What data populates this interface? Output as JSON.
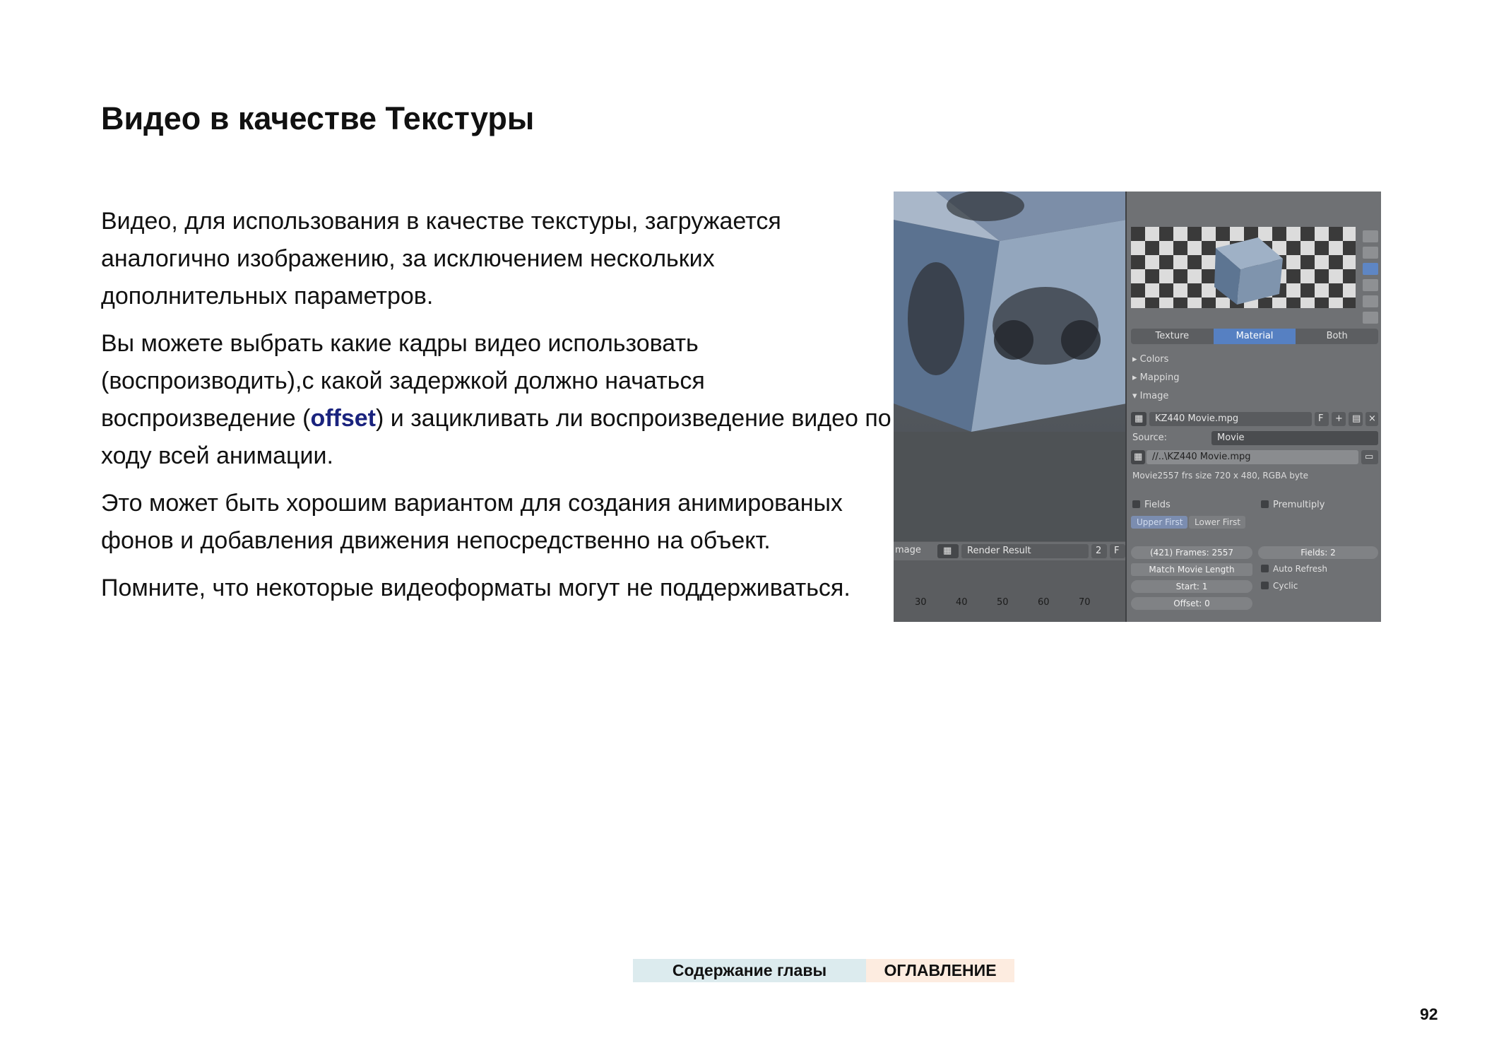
{
  "page": {
    "title": "Видео в качестве Текстуры",
    "paragraphs": {
      "p1": "Видео, для использования в качестве текстуры, загружается аналогично изображению, за исключением нескольких дополнительных параметров.",
      "p2_before": "Вы можете выбрать какие кадры видео использовать (воспроизводить),с какой задержкой должно начаться воспроизведение (",
      "p2_keyword": "offset",
      "p2_after": ") и зацикливать ли воспроизведение видео по ходу всей анимации.",
      "p3": "Это может быть хорошим вариантом для создания анимированых фонов и добавления движения непосредственно на объект.",
      "p4": "Помните, что некоторые видеоформаты могут не поддерживаться."
    },
    "keyword_color": "#1a237e",
    "page_number": "92"
  },
  "navigation": {
    "chapter_label": "Содержание главы",
    "toc_label": "ОГЛАВЛЕНИЕ"
  },
  "screenshot": {
    "tabs": [
      "Texture",
      "Material",
      "Both"
    ],
    "active_tab": "Material",
    "sections": {
      "colors": "▸ Colors",
      "mapping": "▸ Mapping",
      "image": "▾ Image"
    },
    "image_datablock": "KZ440 Movie.mpg",
    "source_label": "Source:",
    "source_value": "Movie",
    "filepath": "//..\\KZ440 Movie.mpg",
    "info": "Movie2557 frs size 720 x 480, RGBA byte",
    "fields_label": "Fields",
    "premultiply_label": "Premultiply",
    "upper_first": "Upper First",
    "lower_first": "Lower First",
    "frames": "(421) Frames: 2557",
    "fields_count": "Fields: 2",
    "match_movie_length": "Match Movie Length",
    "auto_refresh": "Auto Refresh",
    "start": "Start: 1",
    "cyclic": "Cyclic",
    "offset": "Offset: 0",
    "image_editor_label": "mage",
    "render_result": "Render Result",
    "render_slot": "2",
    "timeline_numbers": [
      "30",
      "40",
      "50",
      "60",
      "70"
    ],
    "accent_color": "#5680c2"
  }
}
